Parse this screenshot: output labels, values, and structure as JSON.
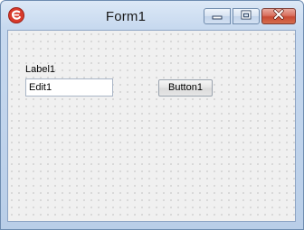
{
  "window": {
    "title": "Form1"
  },
  "titlebar": {
    "app_icon": "lazarus-icon",
    "minimize_icon": "minimize-icon",
    "maximize_icon": "maximize-icon",
    "close_icon": "close-icon"
  },
  "form": {
    "label1": "Label1",
    "edit1_value": "Edit1",
    "button1_label": "Button1"
  },
  "colors": {
    "titlebar": "#c7d9ef",
    "client_background": "#f0f0f0",
    "close_button": "#c84a33",
    "app_icon": "#d93a2b"
  }
}
